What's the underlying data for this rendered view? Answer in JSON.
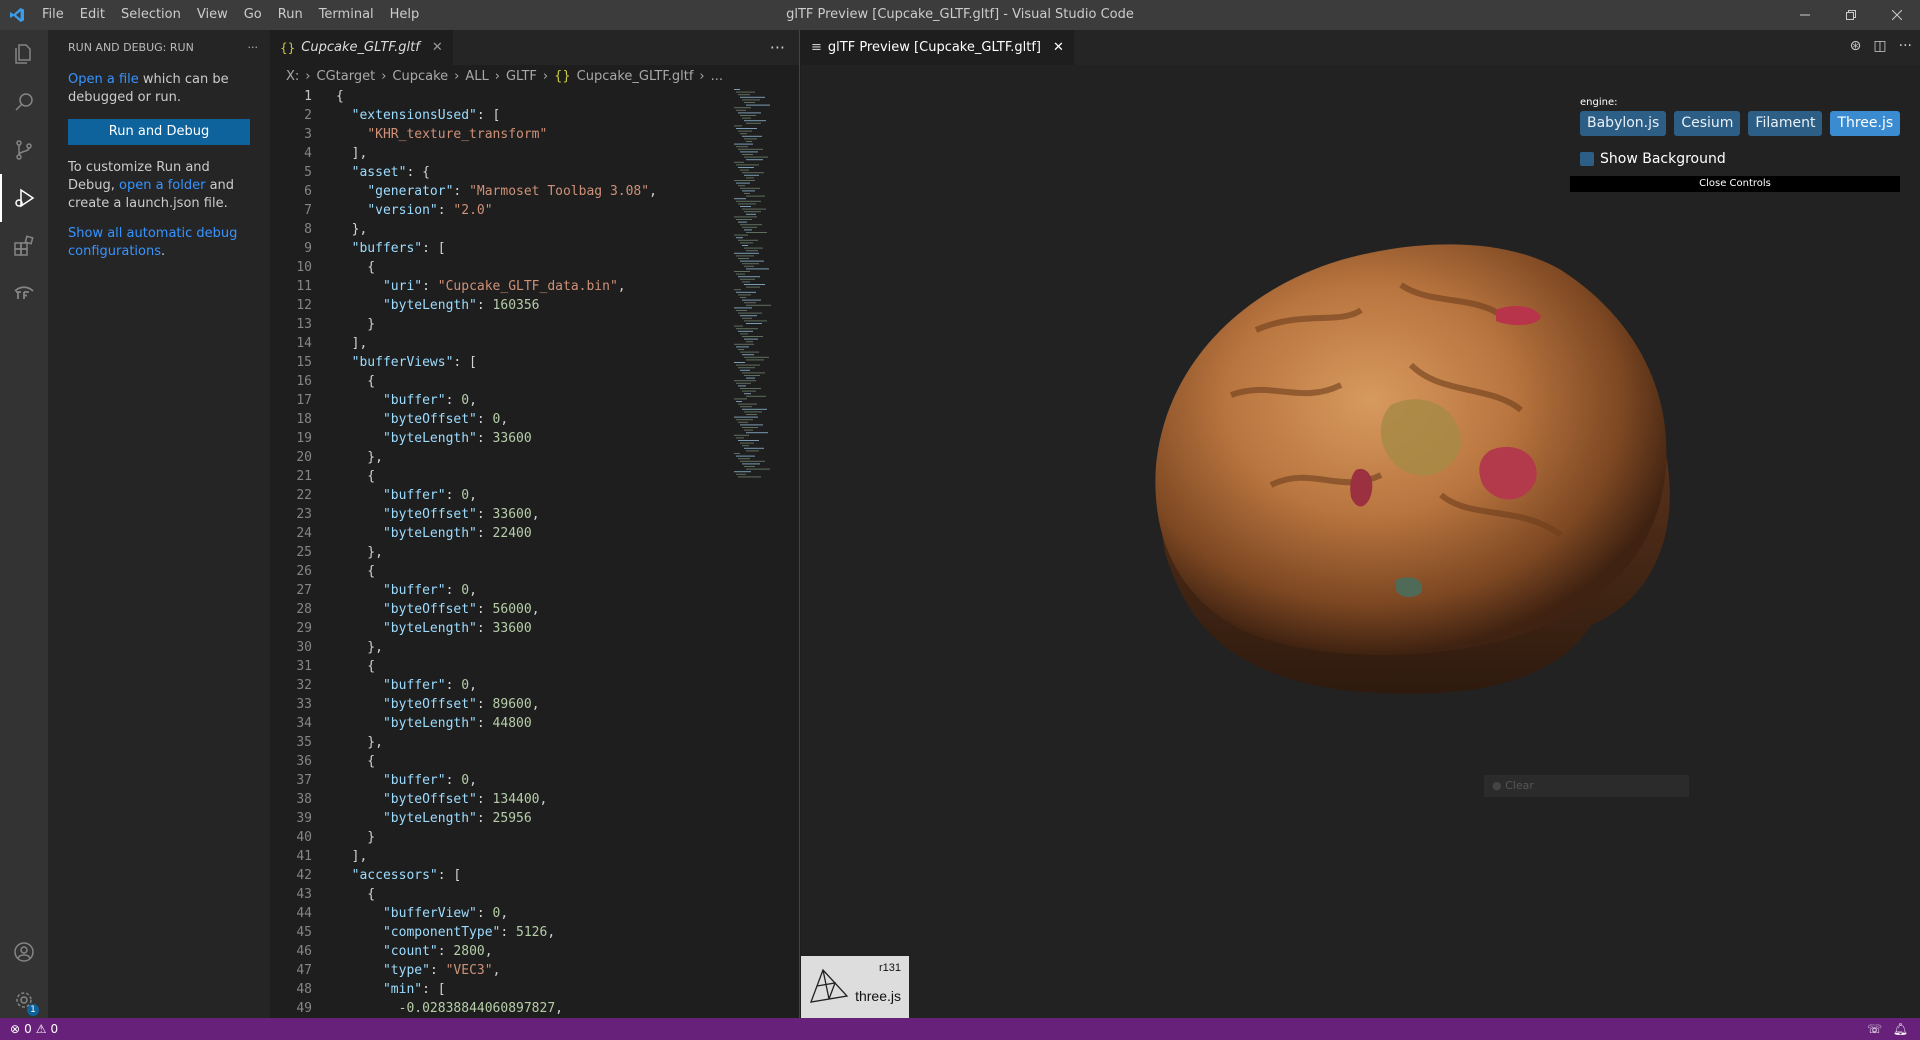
{
  "window": {
    "title": "glTF Preview [Cupcake_GLTF.gltf] - Visual Studio Code"
  },
  "menu": [
    "File",
    "Edit",
    "Selection",
    "View",
    "Go",
    "Run",
    "Terminal",
    "Help"
  ],
  "sidebar": {
    "header": "RUN AND DEBUG: RUN",
    "open_file_link": "Open a file",
    "open_file_rest": " which can be debugged or run.",
    "run_button": "Run and Debug",
    "customize_text": "To customize Run and Debug,",
    "open_folder_link": "open a folder",
    "customize_rest": " and create a launch.json file.",
    "show_all_link": "Show all automatic debug configurations",
    "show_all_rest": "."
  },
  "editor": {
    "tab_label": "Cupcake_GLTF.gltf",
    "breadcrumb": [
      "X:",
      "CGtarget",
      "Cupcake",
      "ALL",
      "GLTF",
      "Cupcake_GLTF.gltf",
      "..."
    ],
    "lines": [
      "{",
      "  \"extensionsUsed\": [",
      "    \"KHR_texture_transform\"",
      "  ],",
      "  \"asset\": {",
      "    \"generator\": \"Marmoset Toolbag 3.08\",",
      "    \"version\": \"2.0\"",
      "  },",
      "  \"buffers\": [",
      "    {",
      "      \"uri\": \"Cupcake_GLTF_data.bin\",",
      "      \"byteLength\": 160356",
      "    }",
      "  ],",
      "  \"bufferViews\": [",
      "    {",
      "      \"buffer\": 0,",
      "      \"byteOffset\": 0,",
      "      \"byteLength\": 33600",
      "    },",
      "    {",
      "      \"buffer\": 0,",
      "      \"byteOffset\": 33600,",
      "      \"byteLength\": 22400",
      "    },",
      "    {",
      "      \"buffer\": 0,",
      "      \"byteOffset\": 56000,",
      "      \"byteLength\": 33600",
      "    },",
      "    {",
      "      \"buffer\": 0,",
      "      \"byteOffset\": 89600,",
      "      \"byteLength\": 44800",
      "    },",
      "    {",
      "      \"buffer\": 0,",
      "      \"byteOffset\": 134400,",
      "      \"byteLength\": 25956",
      "    }",
      "  ],",
      "  \"accessors\": [",
      "    {",
      "      \"bufferView\": 0,",
      "      \"componentType\": 5126,",
      "      \"count\": 2800,",
      "      \"type\": \"VEC3\",",
      "      \"min\": [",
      "        -0.02838844060897827,"
    ]
  },
  "preview": {
    "tab_label": "glTF Preview [Cupcake_GLTF.gltf]",
    "engine_label": "engine:",
    "engines": [
      "Babylon.js",
      "Cesium",
      "Filament",
      "Three.js"
    ],
    "active_engine": "Three.js",
    "show_background": "Show Background",
    "close_controls": "Close Controls",
    "three_version": "r131",
    "three_name": "three.js",
    "clear_label": "Clear"
  },
  "statusbar": {
    "errors": "0",
    "warnings": "0"
  },
  "colors": {
    "accent": "#0e639c",
    "status": "#68217a",
    "link": "#3794ff"
  }
}
